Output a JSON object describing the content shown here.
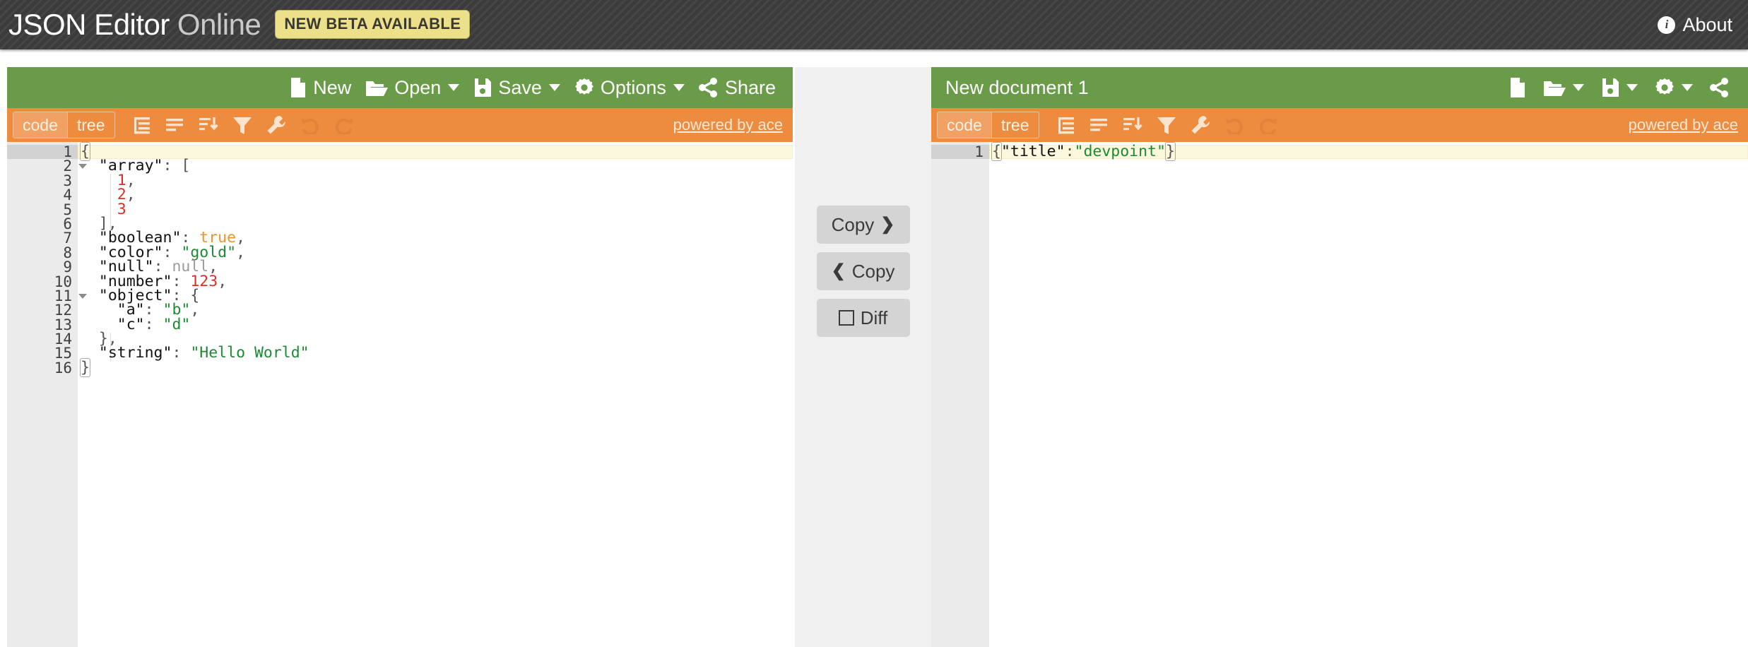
{
  "header": {
    "brand_strong": "JSON Editor",
    "brand_light": "Online",
    "beta_badge": "NEW BETA AVAILABLE",
    "about_label": "About",
    "about_icon": "info-circle-icon",
    "bg_color": "#3e3e3e",
    "badge_color": "#ece08b"
  },
  "colors": {
    "menu_green": "#6a9b48",
    "toolbar_orange": "#ed8b3f",
    "mode_active": "#f0a163",
    "divider_bg": "#f0f0f0",
    "button_gray": "#d4d4d4",
    "gutter_gray": "#ebebeb",
    "active_line": "#fbf8dd"
  },
  "left_pane": {
    "menu": {
      "new": {
        "label": "New",
        "icon": "file-icon"
      },
      "open": {
        "label": "Open",
        "icon": "folder-open-icon",
        "has_caret": true
      },
      "save": {
        "label": "Save",
        "icon": "floppy-disk-icon",
        "has_caret": true
      },
      "options": {
        "label": "Options",
        "icon": "gear-icon",
        "has_caret": true
      },
      "share": {
        "label": "Share",
        "icon": "share-nodes-icon"
      }
    },
    "toolbar": {
      "mode_code": "code",
      "mode_tree": "tree",
      "active_mode": "code",
      "buttons": [
        {
          "name": "format-icon",
          "title": "Format"
        },
        {
          "name": "compact-icon",
          "title": "Compact"
        },
        {
          "name": "sort-icon",
          "title": "Sort"
        },
        {
          "name": "filter-icon",
          "title": "Filter"
        },
        {
          "name": "transform-icon",
          "title": "Transform"
        },
        {
          "name": "undo-icon",
          "title": "Undo",
          "disabled": true
        },
        {
          "name": "redo-icon",
          "title": "Redo",
          "disabled": true
        }
      ],
      "credit": "powered by ace"
    },
    "editor": {
      "active_line_number": 1,
      "lines": [
        {
          "n": 1,
          "fold": true,
          "tokens": [
            {
              "t": "{",
              "c": "punct brace-match"
            }
          ]
        },
        {
          "n": 2,
          "fold": true,
          "tokens": [
            {
              "t": "  \"array\"",
              "c": "key"
            },
            {
              "t": ": [",
              "c": "punct"
            }
          ]
        },
        {
          "n": 3,
          "fold": false,
          "tokens": [
            {
              "t": "    ",
              "c": "punct"
            },
            {
              "t": "1",
              "c": "num"
            },
            {
              "t": ",",
              "c": "punct"
            }
          ]
        },
        {
          "n": 4,
          "fold": false,
          "tokens": [
            {
              "t": "    ",
              "c": "punct"
            },
            {
              "t": "2",
              "c": "num"
            },
            {
              "t": ",",
              "c": "punct"
            }
          ]
        },
        {
          "n": 5,
          "fold": false,
          "tokens": [
            {
              "t": "    ",
              "c": "punct"
            },
            {
              "t": "3",
              "c": "num"
            }
          ]
        },
        {
          "n": 6,
          "fold": false,
          "tokens": [
            {
              "t": "  ],",
              "c": "punct"
            }
          ]
        },
        {
          "n": 7,
          "fold": false,
          "tokens": [
            {
              "t": "  \"boolean\"",
              "c": "key"
            },
            {
              "t": ": ",
              "c": "punct"
            },
            {
              "t": "true",
              "c": "bool"
            },
            {
              "t": ",",
              "c": "punct"
            }
          ]
        },
        {
          "n": 8,
          "fold": false,
          "tokens": [
            {
              "t": "  \"color\"",
              "c": "key"
            },
            {
              "t": ": ",
              "c": "punct"
            },
            {
              "t": "\"gold\"",
              "c": "str"
            },
            {
              "t": ",",
              "c": "punct"
            }
          ]
        },
        {
          "n": 9,
          "fold": false,
          "tokens": [
            {
              "t": "  \"null\"",
              "c": "key"
            },
            {
              "t": ": ",
              "c": "punct"
            },
            {
              "t": "null",
              "c": "null"
            },
            {
              "t": ",",
              "c": "punct"
            }
          ]
        },
        {
          "n": 10,
          "fold": false,
          "tokens": [
            {
              "t": "  \"number\"",
              "c": "key"
            },
            {
              "t": ": ",
              "c": "punct"
            },
            {
              "t": "123",
              "c": "num"
            },
            {
              "t": ",",
              "c": "punct"
            }
          ]
        },
        {
          "n": 11,
          "fold": true,
          "tokens": [
            {
              "t": "  \"object\"",
              "c": "key"
            },
            {
              "t": ": {",
              "c": "punct"
            }
          ]
        },
        {
          "n": 12,
          "fold": false,
          "tokens": [
            {
              "t": "    \"a\"",
              "c": "key"
            },
            {
              "t": ": ",
              "c": "punct"
            },
            {
              "t": "\"b\"",
              "c": "str"
            },
            {
              "t": ",",
              "c": "punct"
            }
          ]
        },
        {
          "n": 13,
          "fold": false,
          "tokens": [
            {
              "t": "    \"c\"",
              "c": "key"
            },
            {
              "t": ": ",
              "c": "punct"
            },
            {
              "t": "\"d\"",
              "c": "str"
            }
          ]
        },
        {
          "n": 14,
          "fold": false,
          "tokens": [
            {
              "t": "  },",
              "c": "punct"
            }
          ]
        },
        {
          "n": 15,
          "fold": false,
          "tokens": [
            {
              "t": "  \"string\"",
              "c": "key"
            },
            {
              "t": ": ",
              "c": "punct"
            },
            {
              "t": "\"Hello World\"",
              "c": "str"
            }
          ]
        },
        {
          "n": 16,
          "fold": false,
          "tokens": [
            {
              "t": "}",
              "c": "punct brace-match"
            }
          ]
        }
      ]
    }
  },
  "divider": {
    "copy_right": {
      "label": "Copy",
      "icon": "chevron-right-icon"
    },
    "copy_left": {
      "label": "Copy",
      "icon": "chevron-left-icon"
    },
    "diff": {
      "label": "Diff",
      "icon": "square-icon"
    }
  },
  "right_pane": {
    "document_title": "New document 1",
    "menu_icons": [
      {
        "name": "file-icon",
        "caret": false
      },
      {
        "name": "folder-open-icon",
        "caret": true
      },
      {
        "name": "floppy-disk-icon",
        "caret": true
      },
      {
        "name": "gear-icon",
        "caret": true
      },
      {
        "name": "share-nodes-icon",
        "caret": false
      }
    ],
    "toolbar": {
      "mode_code": "code",
      "mode_tree": "tree",
      "active_mode": "code",
      "buttons": [
        {
          "name": "format-icon",
          "title": "Format"
        },
        {
          "name": "compact-icon",
          "title": "Compact"
        },
        {
          "name": "sort-icon",
          "title": "Sort"
        },
        {
          "name": "filter-icon",
          "title": "Filter"
        },
        {
          "name": "transform-icon",
          "title": "Transform"
        },
        {
          "name": "undo-icon",
          "title": "Undo",
          "disabled": true
        },
        {
          "name": "redo-icon",
          "title": "Redo",
          "disabled": true
        }
      ],
      "credit": "powered by ace"
    },
    "editor": {
      "active_line_number": 1,
      "lines": [
        {
          "n": 1,
          "fold": false,
          "tokens": [
            {
              "t": "{",
              "c": "punct brace-match"
            },
            {
              "t": "\"title\"",
              "c": "key"
            },
            {
              "t": ":",
              "c": "punct"
            },
            {
              "t": "\"devpoint\"",
              "c": "str"
            },
            {
              "t": "}",
              "c": "punct brace-match"
            }
          ]
        }
      ]
    }
  }
}
